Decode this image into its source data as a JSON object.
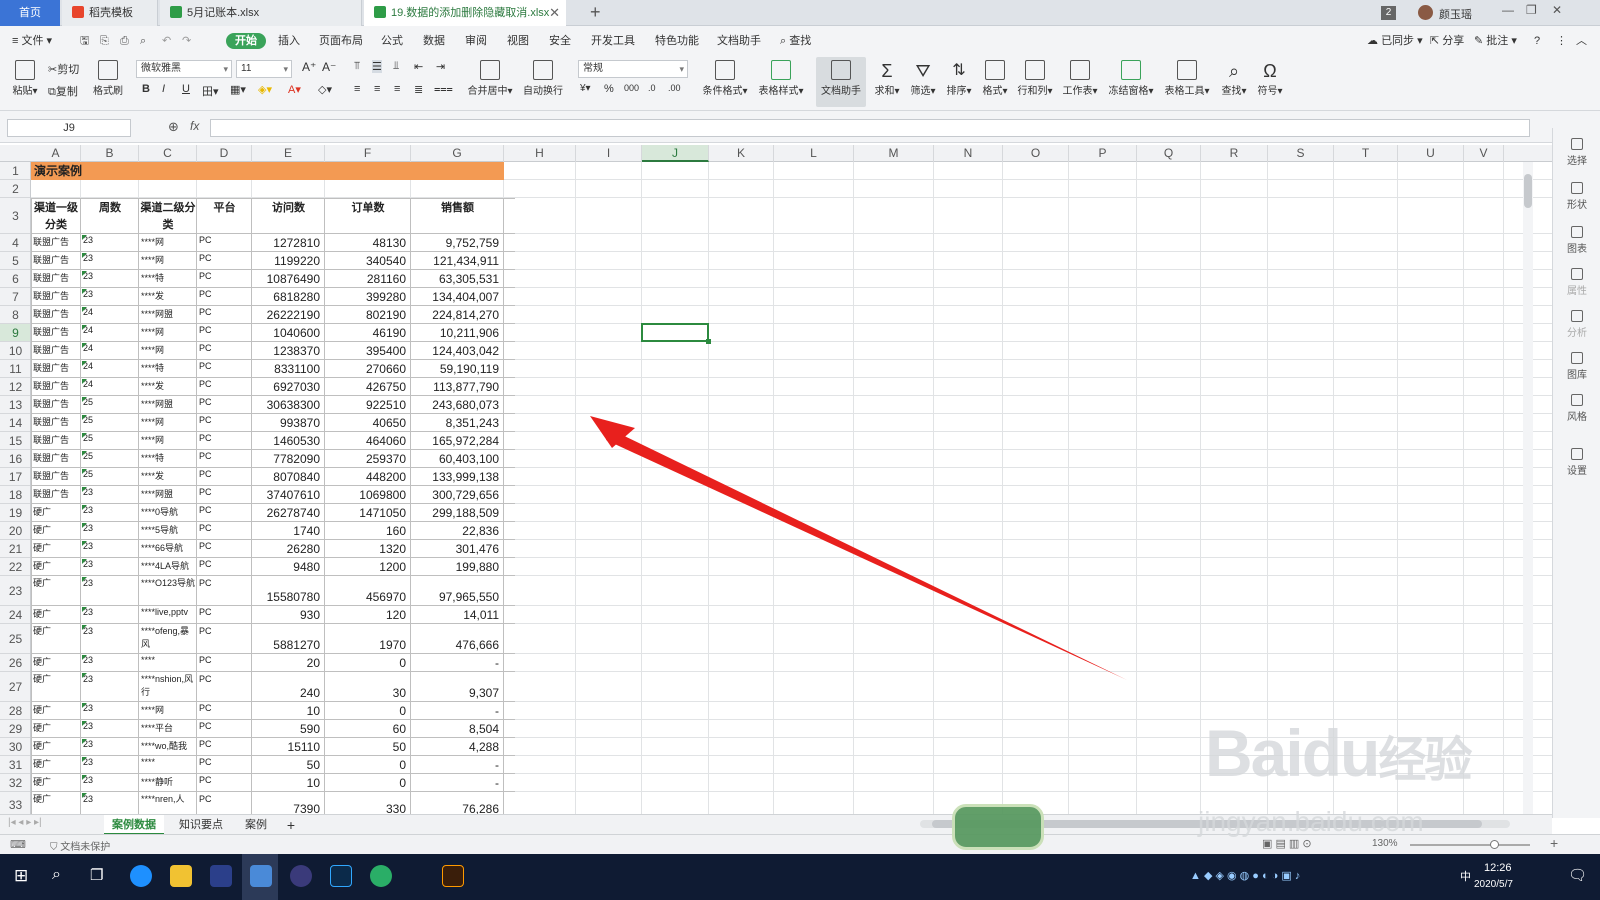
{
  "tabs": {
    "home": "首页",
    "docs": [
      {
        "label": "稻壳模板",
        "icon_color": "#e8452c",
        "active": false
      },
      {
        "label": "5月记账本.xlsx",
        "icon_color": "#2e9c47",
        "active": false
      },
      {
        "label": "19.数据的添加删除隐藏取消.xlsx",
        "icon_color": "#2e9c47",
        "active": true
      }
    ],
    "new_tab": "+",
    "badge": "2",
    "user": "颜玉瑶"
  },
  "menubar": {
    "file": "文件",
    "items": [
      "开始",
      "插入",
      "页面布局",
      "公式",
      "数据",
      "审阅",
      "视图",
      "安全",
      "开发工具",
      "特色功能",
      "文档助手"
    ],
    "search": "查找",
    "sync": "已同步",
    "share": "分享",
    "comment": "批注",
    "help": "?"
  },
  "ribbon": {
    "paste": "粘贴",
    "cut": "剪切",
    "copy": "复制",
    "format_painter": "格式刷",
    "font_name": "微软雅黑",
    "font_size": "11",
    "merge_center": "合并居中",
    "wrap_text": "自动换行",
    "number_format": "常规",
    "conditional_format": "条件格式",
    "table_style": "表格样式",
    "doc_assistant": "文档助手",
    "sum": "求和",
    "filter": "筛选",
    "sort": "排序",
    "format": "格式",
    "row_col": "行和列",
    "worksheet": "工作表",
    "freeze": "冻结窗格",
    "table_tools": "表格工具",
    "find": "查找",
    "symbol": "符号"
  },
  "formula_bar": {
    "name_box": "J9",
    "fx": "fx",
    "formula": ""
  },
  "columns": [
    "A",
    "B",
    "C",
    "D",
    "E",
    "F",
    "G",
    "H",
    "I",
    "J",
    "K",
    "L",
    "M",
    "N",
    "O",
    "P",
    "Q",
    "R",
    "S",
    "T",
    "U",
    "V"
  ],
  "selected_cell": "J9",
  "sheet": {
    "title": "演示案例",
    "headers": [
      "渠道一级分类",
      "周数",
      "渠道二级分类",
      "平台",
      "访问数",
      "订单数",
      "销售额"
    ],
    "rows": [
      {
        "n": "4",
        "a": "联盟广告",
        "b": "23",
        "c": "****网",
        "d": "PC",
        "e": "1272810",
        "f": "48130",
        "g": "9,752,759"
      },
      {
        "n": "5",
        "a": "联盟广告",
        "b": "23",
        "c": "****网",
        "d": "PC",
        "e": "1199220",
        "f": "340540",
        "g": "121,434,911"
      },
      {
        "n": "6",
        "a": "联盟广告",
        "b": "23",
        "c": "****特",
        "d": "PC",
        "e": "10876490",
        "f": "281160",
        "g": "63,305,531"
      },
      {
        "n": "7",
        "a": "联盟广告",
        "b": "23",
        "c": "****发",
        "d": "PC",
        "e": "6818280",
        "f": "399280",
        "g": "134,404,007"
      },
      {
        "n": "8",
        "a": "联盟广告",
        "b": "24",
        "c": "****网盟",
        "d": "PC",
        "e": "26222190",
        "f": "802190",
        "g": "224,814,270"
      },
      {
        "n": "9",
        "a": "联盟广告",
        "b": "24",
        "c": "****网",
        "d": "PC",
        "e": "1040600",
        "f": "46190",
        "g": "10,211,906"
      },
      {
        "n": "10",
        "a": "联盟广告",
        "b": "24",
        "c": "****网",
        "d": "PC",
        "e": "1238370",
        "f": "395400",
        "g": "124,403,042"
      },
      {
        "n": "11",
        "a": "联盟广告",
        "b": "24",
        "c": "****特",
        "d": "PC",
        "e": "8331100",
        "f": "270660",
        "g": "59,190,119"
      },
      {
        "n": "12",
        "a": "联盟广告",
        "b": "24",
        "c": "****发",
        "d": "PC",
        "e": "6927030",
        "f": "426750",
        "g": "113,877,790"
      },
      {
        "n": "13",
        "a": "联盟广告",
        "b": "25",
        "c": "****网盟",
        "d": "PC",
        "e": "30638300",
        "f": "922510",
        "g": "243,680,073"
      },
      {
        "n": "14",
        "a": "联盟广告",
        "b": "25",
        "c": "****网",
        "d": "PC",
        "e": "993870",
        "f": "40650",
        "g": "8,351,243"
      },
      {
        "n": "15",
        "a": "联盟广告",
        "b": "25",
        "c": "****网",
        "d": "PC",
        "e": "1460530",
        "f": "464060",
        "g": "165,972,284"
      },
      {
        "n": "16",
        "a": "联盟广告",
        "b": "25",
        "c": "****特",
        "d": "PC",
        "e": "7782090",
        "f": "259370",
        "g": "60,403,100"
      },
      {
        "n": "17",
        "a": "联盟广告",
        "b": "25",
        "c": "****发",
        "d": "PC",
        "e": "8070840",
        "f": "448200",
        "g": "133,999,138"
      },
      {
        "n": "18",
        "a": "联盟广告",
        "b": "23",
        "c": "****网盟",
        "d": "PC",
        "e": "37407610",
        "f": "1069800",
        "g": "300,729,656"
      },
      {
        "n": "19",
        "a": "硬广",
        "b": "23",
        "c": "****0导航",
        "d": "PC",
        "e": "26278740",
        "f": "1471050",
        "g": "299,188,509"
      },
      {
        "n": "20",
        "a": "硬广",
        "b": "23",
        "c": "****5导航",
        "d": "PC",
        "e": "1740",
        "f": "160",
        "g": "22,836"
      },
      {
        "n": "21",
        "a": "硬广",
        "b": "23",
        "c": "****66导航",
        "d": "PC",
        "e": "26280",
        "f": "1320",
        "g": "301,476"
      },
      {
        "n": "22",
        "a": "硬广",
        "b": "23",
        "c": "****4LA导航",
        "d": "PC",
        "e": "9480",
        "f": "1200",
        "g": "199,880"
      },
      {
        "n": "23",
        "a": "硬广",
        "b": "23",
        "c": "****O123导航",
        "d": "PC",
        "e": "15580780",
        "f": "456970",
        "g": "97,965,550"
      },
      {
        "n": "24",
        "a": "硬广",
        "b": "23",
        "c": "****live,pptv",
        "d": "PC",
        "e": "930",
        "f": "120",
        "g": "14,011"
      },
      {
        "n": "25",
        "a": "硬广",
        "b": "23",
        "c": "****ofeng,暴风",
        "d": "PC",
        "e": "5881270",
        "f": "1970",
        "g": "476,666"
      },
      {
        "n": "26",
        "a": "硬广",
        "b": "23",
        "c": "****",
        "d": "PC",
        "e": "20",
        "f": "0",
        "g": "-"
      },
      {
        "n": "27",
        "a": "硬广",
        "b": "23",
        "c": "****nshion,风行",
        "d": "PC",
        "e": "240",
        "f": "30",
        "g": "9,307"
      },
      {
        "n": "28",
        "a": "硬广",
        "b": "23",
        "c": "****网",
        "d": "PC",
        "e": "10",
        "f": "0",
        "g": "-"
      },
      {
        "n": "29",
        "a": "硬广",
        "b": "23",
        "c": "****平台",
        "d": "PC",
        "e": "590",
        "f": "60",
        "g": "8,504"
      },
      {
        "n": "30",
        "a": "硬广",
        "b": "23",
        "c": "****wo,酷我",
        "d": "PC",
        "e": "15110",
        "f": "50",
        "g": "4,288"
      },
      {
        "n": "31",
        "a": "硬广",
        "b": "23",
        "c": "****",
        "d": "PC",
        "e": "50",
        "f": "0",
        "g": "-"
      },
      {
        "n": "32",
        "a": "硬广",
        "b": "23",
        "c": "****静听",
        "d": "PC",
        "e": "10",
        "f": "0",
        "g": "-"
      },
      {
        "n": "33",
        "a": "硬广",
        "b": "23",
        "c": "****nren,人",
        "d": "PC",
        "e": "7390",
        "f": "330",
        "g": "76,286"
      }
    ]
  },
  "side_panel": [
    "选择",
    "形状",
    "图表",
    "属性",
    "分析",
    "图库",
    "风格",
    "设置"
  ],
  "sheet_tabs": [
    "案例数据",
    "知识要点",
    "案例"
  ],
  "status": {
    "protect": "文档未保护",
    "zoom": "130%"
  },
  "taskbar": {
    "time": "12:26",
    "date": "2020/5/7",
    "ime": "中"
  },
  "watermark": {
    "line1": "Bai",
    "line2": "du",
    "line3": "经验",
    "url": "jingyan.baidu.com"
  },
  "colors": {
    "accent": "#2c8a3f",
    "title_fill": "#f39a53",
    "arrow": "#e8201d",
    "taskbar": "#0f1b33"
  }
}
